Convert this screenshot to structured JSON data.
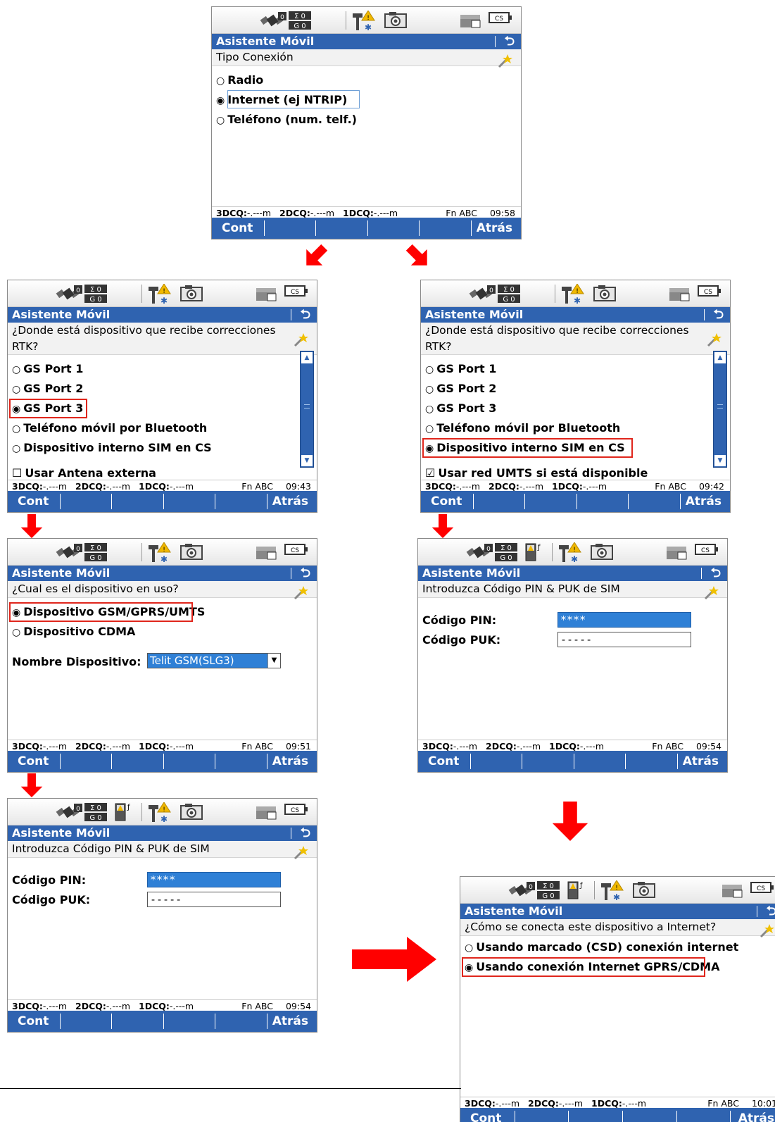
{
  "common": {
    "status_glyphs": {
      "sigma_row": "Σ 0",
      "g_row": "G 0",
      "cs_badge": "CS"
    },
    "header_title": "Asistente Móvil",
    "back_glyph": "⮌",
    "softkeys": {
      "left": "Cont",
      "right": "Atrás"
    },
    "footer": {
      "q3_label": "3DCQ:",
      "q3_val": "-.---m",
      "q2_label": "2DCQ:",
      "q2_val": "-.---m",
      "q1_label": "1DCQ:",
      "q1_val": "-.---m",
      "mode": "Fn ABC"
    }
  },
  "screens": [
    {
      "id": "s1",
      "question": "Tipo Conexión",
      "time": "09:58",
      "options": [
        {
          "label": "Radio",
          "selected": false
        },
        {
          "label": "Internet (ej NTRIP)",
          "selected": true
        },
        {
          "label": "Teléfono (num. telf.)",
          "selected": false
        }
      ]
    },
    {
      "id": "s2",
      "question": "¿Donde está dispositivo que recibe correcciones RTK?",
      "time": "09:43",
      "options": [
        {
          "label": "GS Port 1",
          "selected": false
        },
        {
          "label": "GS Port 2",
          "selected": false
        },
        {
          "label": "GS Port 3",
          "selected": true
        },
        {
          "label": "Teléfono móvil por Bluetooth",
          "selected": false
        },
        {
          "label": "Dispositivo interno SIM en CS",
          "selected": false
        }
      ],
      "checkbox": {
        "label": "Usar Antena externa",
        "checked": false
      }
    },
    {
      "id": "s3",
      "question": "¿Donde está dispositivo que recibe correcciones RTK?",
      "time": "09:42",
      "options": [
        {
          "label": "GS Port 1",
          "selected": false
        },
        {
          "label": "GS Port 2",
          "selected": false
        },
        {
          "label": "GS Port 3",
          "selected": false
        },
        {
          "label": "Teléfono móvil por Bluetooth",
          "selected": false
        },
        {
          "label": "Dispositivo interno SIM en CS",
          "selected": true
        }
      ],
      "checkbox": {
        "label": "Usar red UMTS si está disponible",
        "checked": true
      }
    },
    {
      "id": "s4",
      "question": "¿Cual es el dispositivo en uso?",
      "time": "09:51",
      "options": [
        {
          "label": "Dispositivo GSM/GPRS/UMTS",
          "selected": true
        },
        {
          "label": "Dispositivo CDMA",
          "selected": false
        }
      ],
      "field_label": "Nombre Dispositivo:",
      "field_value": "Telit GSM(SLG3)"
    },
    {
      "id": "s5",
      "question": "Introduzca Código PIN & PUK de SIM",
      "time": "09:54",
      "pin_label": "Código PIN:",
      "pin_value": "****",
      "puk_label": "Código PUK:",
      "puk_value": "-----"
    },
    {
      "id": "s6",
      "question": "Introduzca Código PIN & PUK de SIM",
      "time": "09:54",
      "pin_label": "Código PIN:",
      "pin_value": "****",
      "puk_label": "Código PUK:",
      "puk_value": "-----"
    },
    {
      "id": "s7",
      "question": "¿Cómo se conecta este dispositivo a Internet?",
      "time": "10:01",
      "options": [
        {
          "label": "Usando marcado (CSD) conexión internet",
          "selected": false
        },
        {
          "label": "Usando conexión Internet GPRS/CDMA",
          "selected": true
        }
      ]
    }
  ],
  "colors": {
    "header_blue": "#2f63b0",
    "highlight_red": "#e0261c",
    "arrow_red": "#ff0000",
    "field_blue": "#2f80d6"
  }
}
